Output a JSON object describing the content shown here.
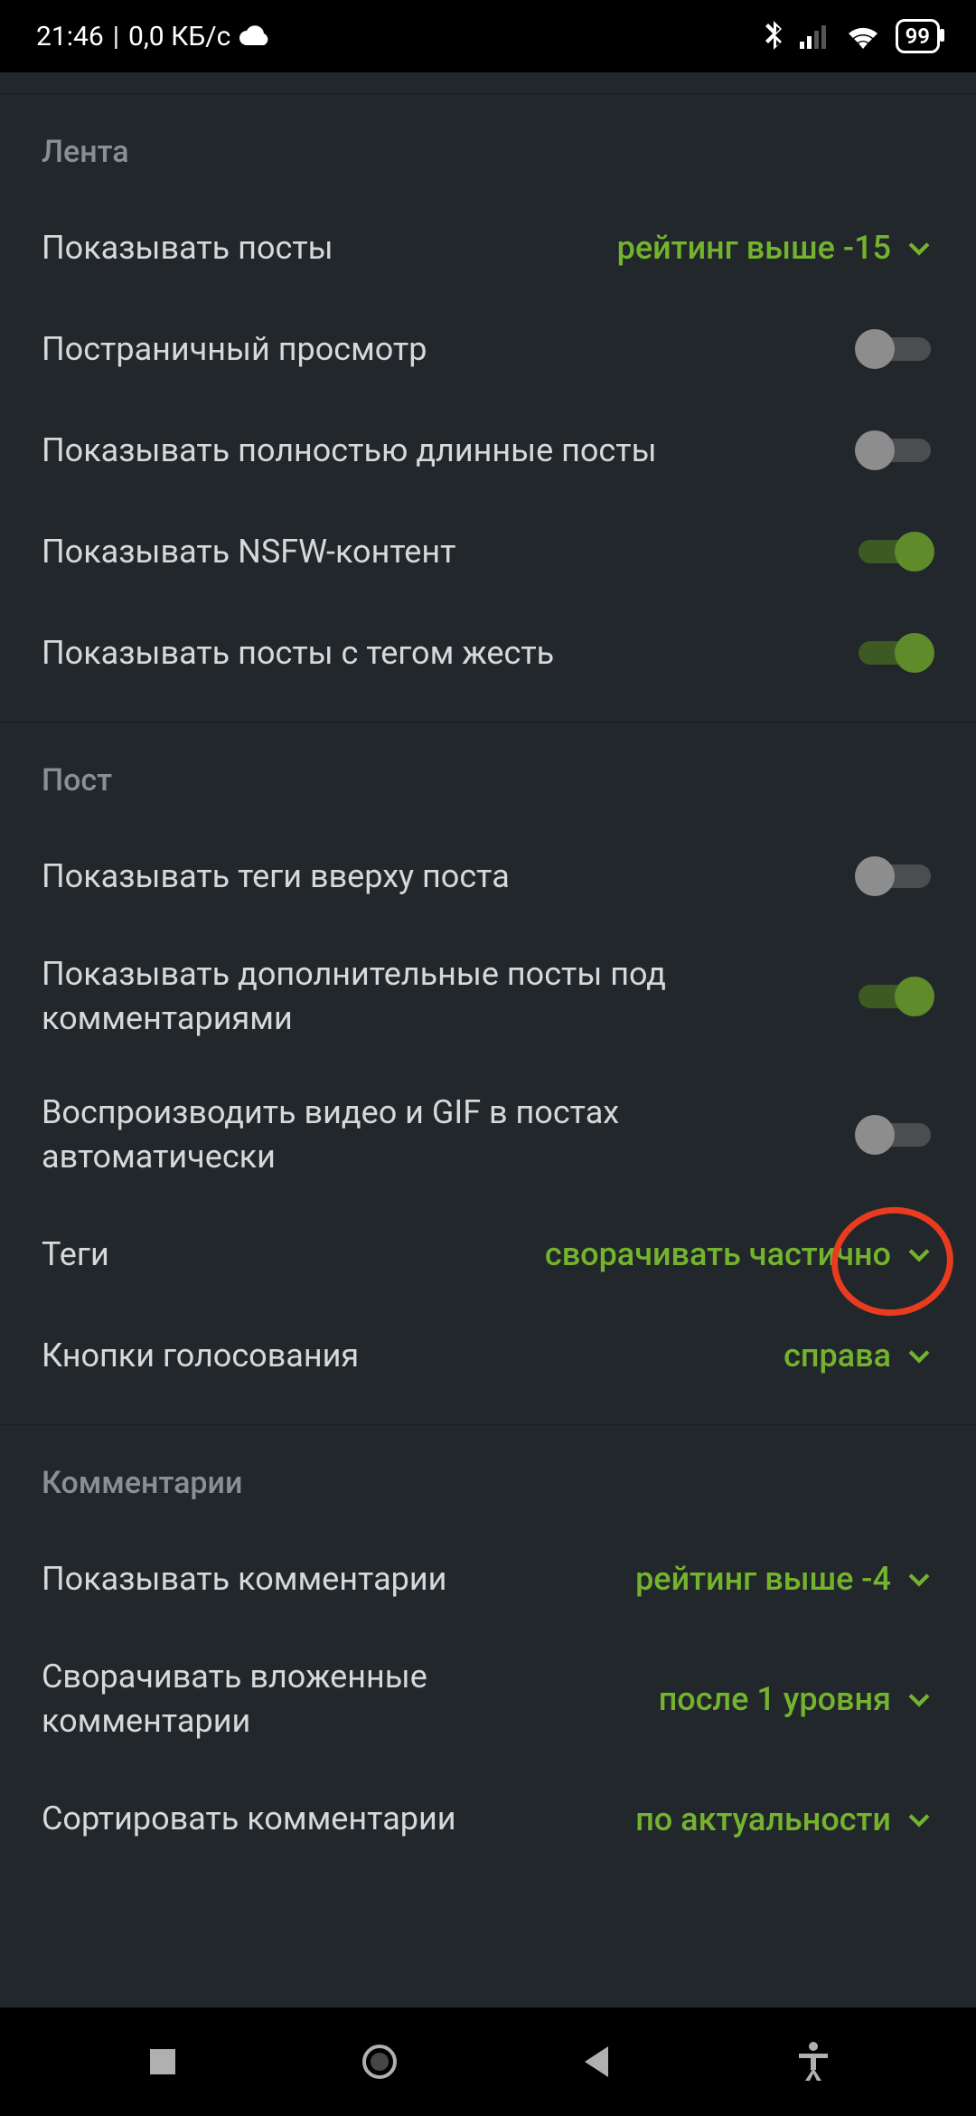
{
  "status": {
    "time": "21:46",
    "net_speed": "0,0 КБ/c",
    "battery": "99"
  },
  "sections": {
    "feed": {
      "title": "Лента",
      "show_posts_label": "Показывать посты",
      "show_posts_value": "рейтинг выше -15",
      "paginated_label": "Постраничный просмотр",
      "full_long_label": "Показывать полностью длинные посты",
      "nsfw_label": "Показывать NSFW-контент",
      "gore_label": "Показывать посты с тегом жесть"
    },
    "post": {
      "title": "Пост",
      "tags_top_label": "Показывать теги вверху поста",
      "extra_posts_label": "Показывать дополнительные посты под комментариями",
      "autoplay_label": "Воспроизводить видео и GIF в постах автоматически",
      "tags_label": "Теги",
      "tags_value": "сворачивать частично",
      "vote_buttons_label": "Кнопки голосования",
      "vote_buttons_value": "справа"
    },
    "comments": {
      "title": "Комментарии",
      "show_comments_label": "Показывать комментарии",
      "show_comments_value": "рейтинг выше -4",
      "collapse_label": "Сворачивать вложенные комментарии",
      "collapse_value": "после 1 уровня",
      "sort_label": "Сортировать комментарии",
      "sort_value": "по актуальности"
    }
  },
  "colors": {
    "accent": "#74b32e",
    "bg": "#22272b",
    "annotation": "#e83b1f"
  }
}
